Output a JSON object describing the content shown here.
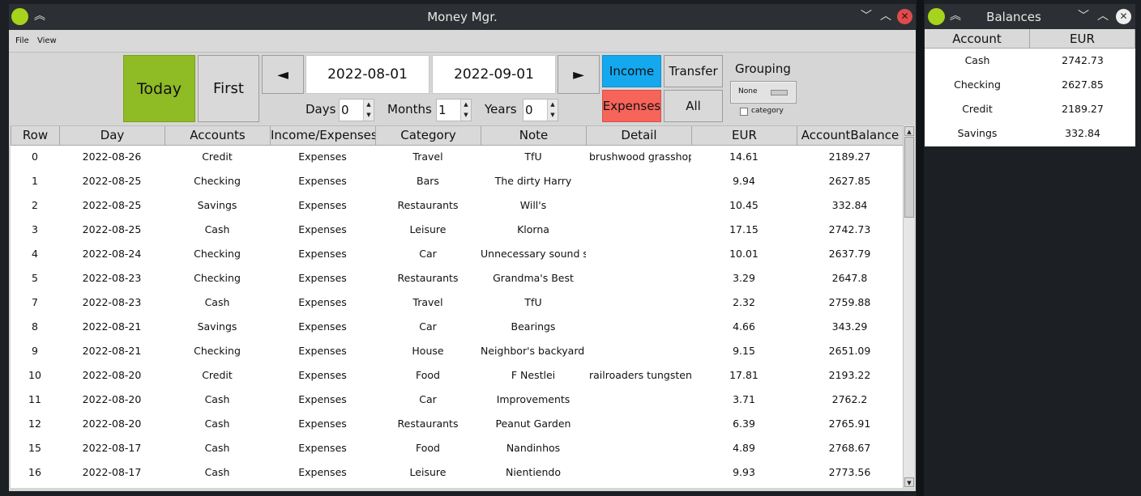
{
  "main_window": {
    "title": "Money Mgr.",
    "menu": [
      "File",
      "View"
    ],
    "toolbar": {
      "today_label": "Today",
      "first_label": "First",
      "prev_label": "◄",
      "next_label": "►",
      "date_from": "2022-08-01",
      "date_to": "2022-09-01",
      "days_label": "Days",
      "days_value": "0",
      "months_label": "Months",
      "months_value": "1",
      "years_label": "Years",
      "years_value": "0",
      "income_label": "Income",
      "transfer_label": "Transfer",
      "expenses_label": "Expenses",
      "all_label": "All",
      "grouping_label": "Grouping",
      "grouping_value": "None",
      "category_checkbox_label": "category",
      "category_checked": false
    },
    "table": {
      "columns": [
        "Row",
        "Day",
        "Accounts",
        "Income/Expenses",
        "Category",
        "Note",
        "Detail",
        "EUR",
        "AccountBalance"
      ],
      "rows": [
        [
          "0",
          "2022-08-26",
          "Credit",
          "Expenses",
          "Travel",
          "TfU",
          "brushwood grasshop",
          "14.61",
          "2189.27"
        ],
        [
          "1",
          "2022-08-25",
          "Checking",
          "Expenses",
          "Bars",
          "The dirty Harry",
          "",
          "9.94",
          "2627.85"
        ],
        [
          "2",
          "2022-08-25",
          "Savings",
          "Expenses",
          "Restaurants",
          "Will's",
          "",
          "10.45",
          "332.84"
        ],
        [
          "3",
          "2022-08-25",
          "Cash",
          "Expenses",
          "Leisure",
          "Klorna",
          "",
          "17.15",
          "2742.73"
        ],
        [
          "4",
          "2022-08-24",
          "Checking",
          "Expenses",
          "Car",
          "Unnecessary sound s",
          "",
          "10.01",
          "2637.79"
        ],
        [
          "5",
          "2022-08-23",
          "Checking",
          "Expenses",
          "Restaurants",
          "Grandma's Best",
          "",
          "3.29",
          "2647.8"
        ],
        [
          "7",
          "2022-08-23",
          "Cash",
          "Expenses",
          "Travel",
          "TfU",
          "",
          "2.32",
          "2759.88"
        ],
        [
          "8",
          "2022-08-21",
          "Savings",
          "Expenses",
          "Car",
          "Bearings",
          "",
          "4.66",
          "343.29"
        ],
        [
          "9",
          "2022-08-21",
          "Checking",
          "Expenses",
          "House",
          "Neighbor's backyard s",
          "",
          "9.15",
          "2651.09"
        ],
        [
          "10",
          "2022-08-20",
          "Credit",
          "Expenses",
          "Food",
          "F Nestlei",
          "railroaders tungsten'",
          "17.81",
          "2193.22"
        ],
        [
          "11",
          "2022-08-20",
          "Cash",
          "Expenses",
          "Car",
          "Improvements",
          "",
          "3.71",
          "2762.2"
        ],
        [
          "12",
          "2022-08-20",
          "Cash",
          "Expenses",
          "Restaurants",
          "Peanut Garden",
          "",
          "6.39",
          "2765.91"
        ],
        [
          "15",
          "2022-08-17",
          "Cash",
          "Expenses",
          "Food",
          "Nandinhos",
          "",
          "4.89",
          "2768.67"
        ],
        [
          "16",
          "2022-08-17",
          "Cash",
          "Expenses",
          "Leisure",
          "Nientiendo",
          "",
          "9.93",
          "2773.56"
        ]
      ]
    }
  },
  "balances_window": {
    "title": "Balances",
    "columns": [
      "Account",
      "EUR"
    ],
    "rows": [
      [
        "Cash",
        "2742.73"
      ],
      [
        "Checking",
        "2627.85"
      ],
      [
        "Credit",
        "2189.27"
      ],
      [
        "Savings",
        "332.84"
      ]
    ]
  },
  "icons": {
    "window_menu": "circle-dot-icon",
    "shade": "chevrons-up-icon",
    "minimize": "chevron-down-icon",
    "maximize": "chevron-up-icon",
    "close": "close-icon"
  },
  "colors": {
    "today": "#8fbb25",
    "income": "#14a8ee",
    "expenses": "#f6645a",
    "close_button": "#e04b4b",
    "window_dot": "#a6d41c"
  }
}
